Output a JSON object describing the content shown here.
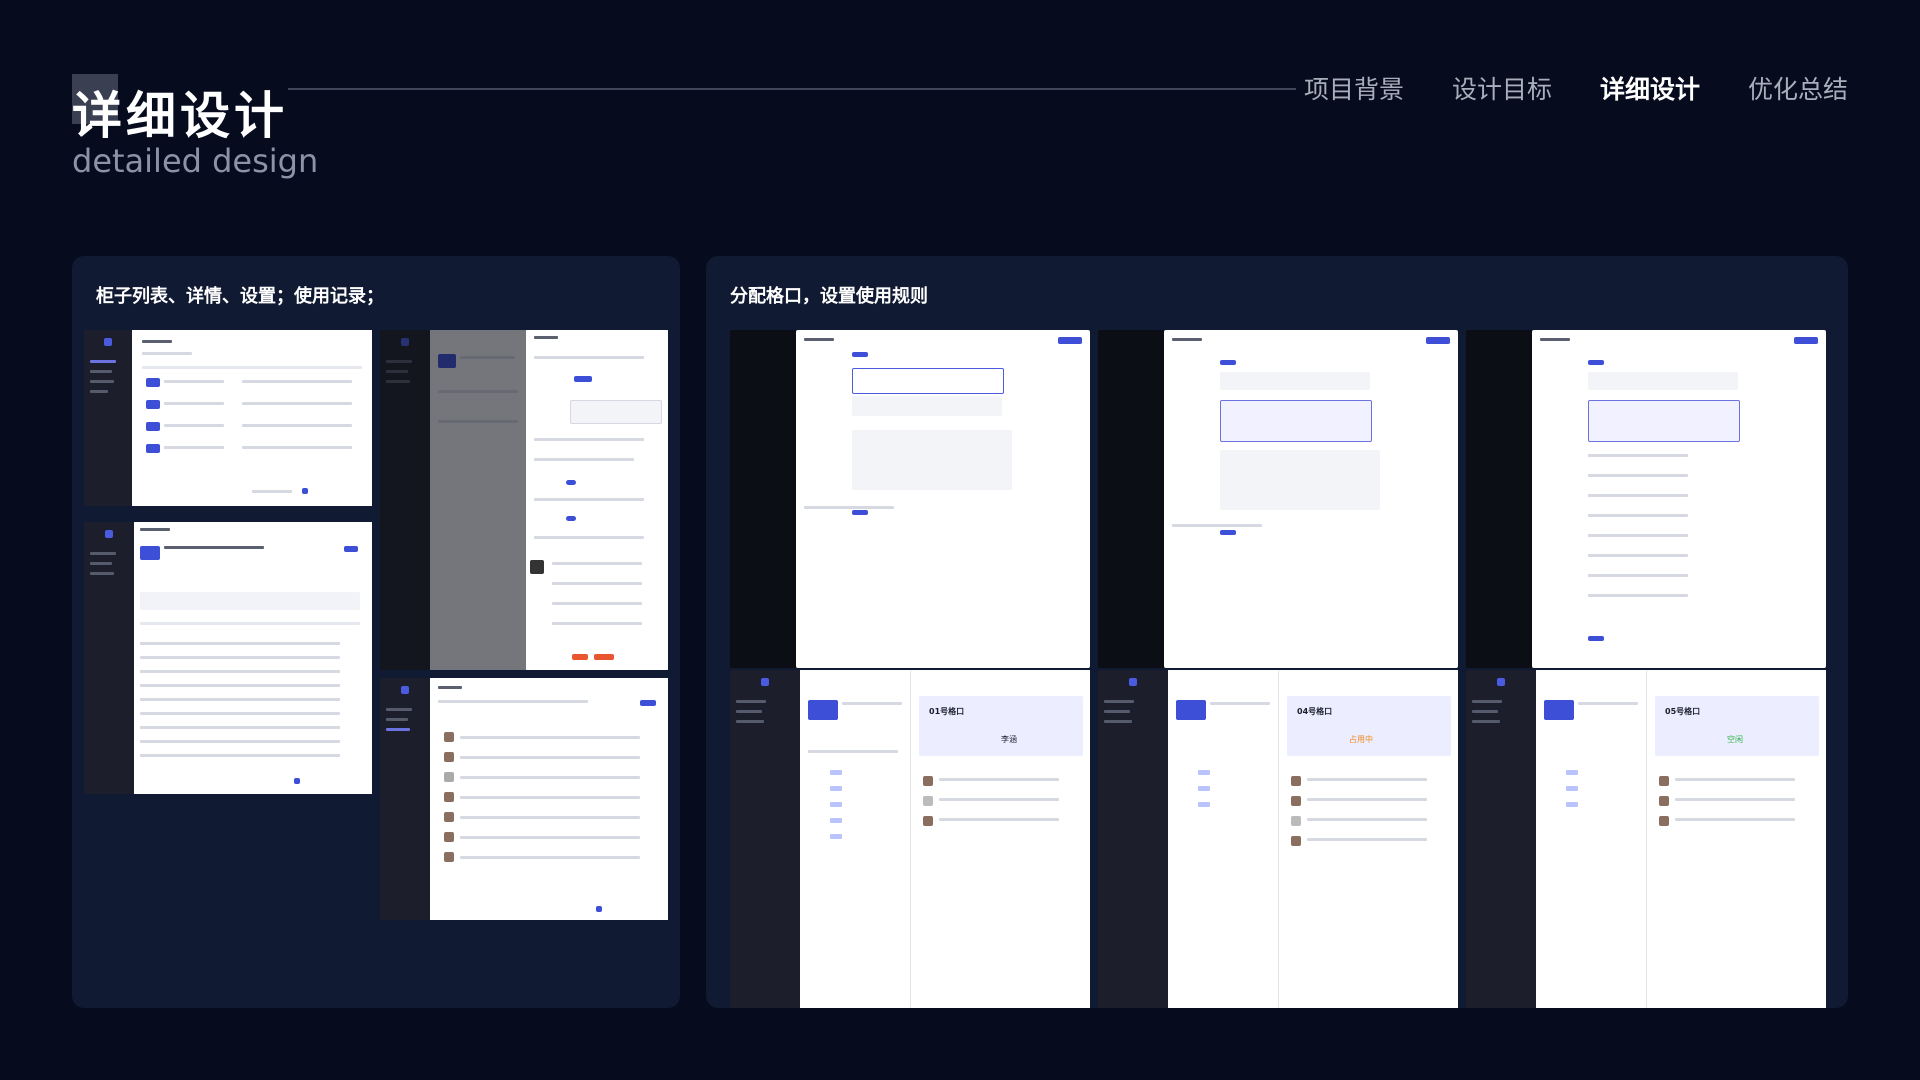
{
  "header": {
    "title": "详细设计",
    "subtitle": "detailed design",
    "nav": [
      "项目背景",
      "设计目标",
      "详细设计",
      "优化总结"
    ],
    "active_nav": "详细设计"
  },
  "panels": {
    "left": {
      "title": "柜子列表、详情、设置；使用记录；"
    },
    "right": {
      "title": "分配格口，设置使用规则"
    }
  },
  "mockups": {
    "slot_labels": [
      "01号格口",
      "04号格口",
      "05号格口"
    ],
    "assignee": "李涵",
    "status_occupied": "占用中",
    "status_free": "空闲"
  },
  "colors": {
    "background": "#060b1e",
    "panel": "#111a33",
    "accent": "#3d4fd6",
    "danger": "#e8552f"
  }
}
